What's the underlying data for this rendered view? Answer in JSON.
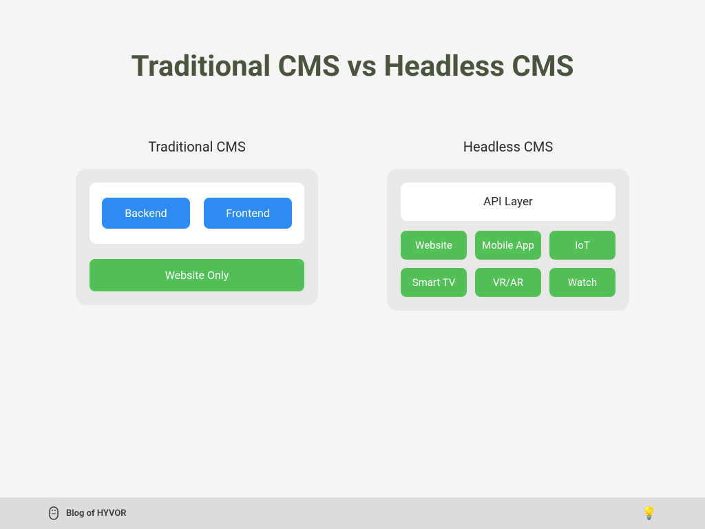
{
  "title": "Traditional CMS vs Headless CMS",
  "traditional": {
    "heading": "Traditional CMS",
    "backend": "Backend",
    "frontend": "Frontend",
    "output": "Website Only"
  },
  "headless": {
    "heading": "Headless CMS",
    "api": "API Layer",
    "targets": [
      "Website",
      "Mobile App",
      "IoT",
      "Smart TV",
      "VR/AR",
      "Watch"
    ]
  },
  "footer": {
    "brand": "Blog of HYVOR"
  }
}
